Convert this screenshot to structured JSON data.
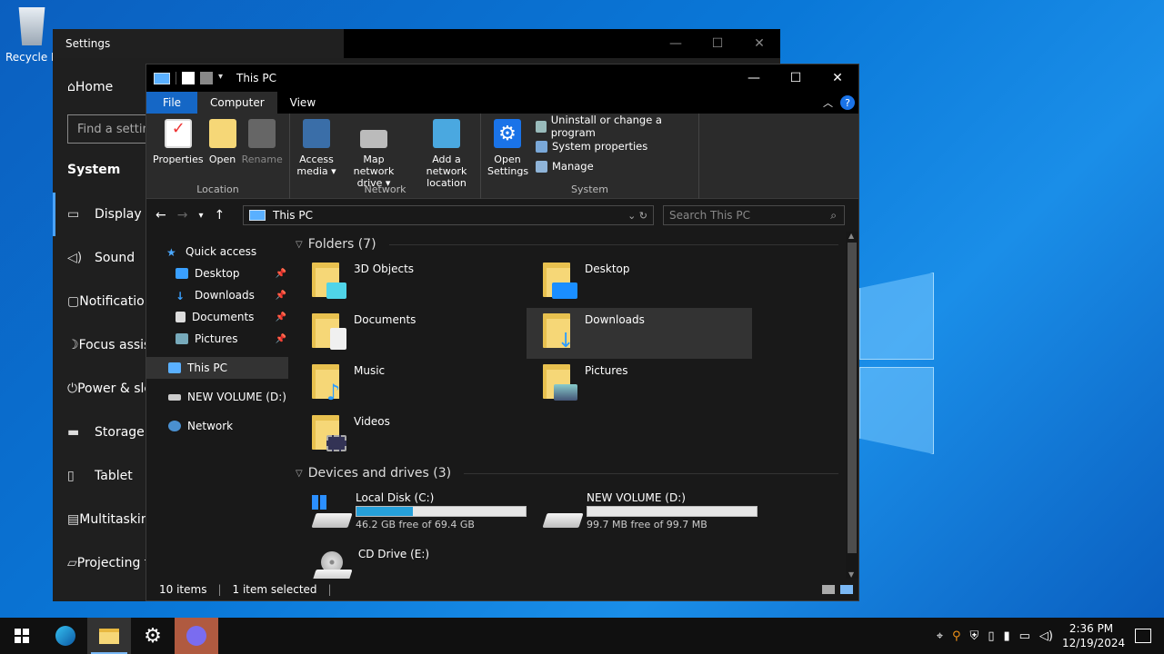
{
  "desktop": {
    "recycle_label": "Recycle Bin"
  },
  "settings": {
    "title": "Settings",
    "home_label": "Home",
    "find_placeholder": "Find a setting",
    "section": "System",
    "nav": [
      "Display",
      "Sound",
      "Notifications & actions",
      "Focus assist",
      "Power & sleep",
      "Storage",
      "Tablet",
      "Multitasking",
      "Projecting to this PC"
    ]
  },
  "explorer": {
    "title": "This PC",
    "tabs": {
      "file": "File",
      "computer": "Computer",
      "view": "View"
    },
    "ribbon": {
      "location": {
        "label": "Location",
        "properties": "Properties",
        "open": "Open",
        "rename": "Rename"
      },
      "network": {
        "label": "Network",
        "access_media": "Access media ▾",
        "map_drive": "Map network drive ▾",
        "add_location": "Add a network location"
      },
      "system": {
        "label": "System",
        "open_settings": "Open Settings",
        "uninstall": "Uninstall or change a program",
        "system_properties": "System properties",
        "manage": "Manage"
      }
    },
    "address": "This PC",
    "search_placeholder": "Search This PC",
    "tree": {
      "quick_access": "Quick access",
      "desktop": "Desktop",
      "downloads": "Downloads",
      "documents": "Documents",
      "pictures": "Pictures",
      "this_pc": "This PC",
      "new_volume": "NEW VOLUME (D:)",
      "network": "Network"
    },
    "folders_header": "Folders (7)",
    "folders": {
      "objects3d": "3D Objects",
      "desktop": "Desktop",
      "documents": "Documents",
      "downloads": "Downloads",
      "music": "Music",
      "pictures": "Pictures",
      "videos": "Videos"
    },
    "drives_header": "Devices and drives (3)",
    "drives": {
      "c": {
        "name": "Local Disk (C:)",
        "free": "46.2 GB free of 69.4 GB",
        "used_fraction": 0.334
      },
      "d": {
        "name": "NEW VOLUME (D:)",
        "free": "99.7 MB free of 99.7 MB",
        "used_fraction": 0.0
      },
      "e": {
        "name": "CD Drive (E:)"
      }
    },
    "status": {
      "items": "10 items",
      "selected": "1 item selected"
    }
  },
  "taskbar": {
    "time": "2:36 PM",
    "date": "12/19/2024"
  },
  "colors": {
    "accent": "#1567c6",
    "drive_fill": "#26a0da",
    "folder": "#f6d777"
  }
}
